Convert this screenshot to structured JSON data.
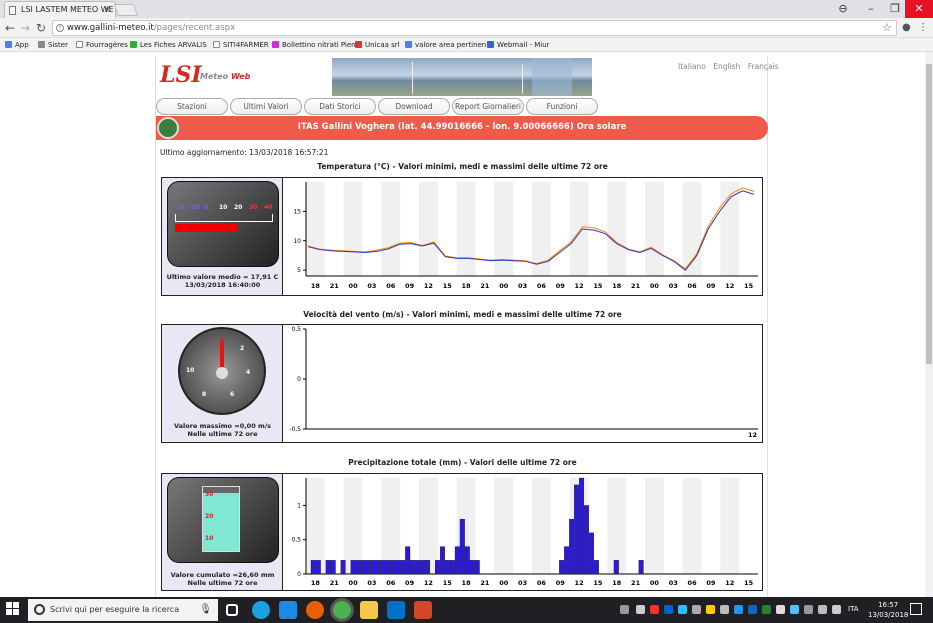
{
  "browser": {
    "tab_title": "LSI LASTEM METEO WE",
    "url_domain": "www.gallini-meteo.it",
    "url_path": "/pages/recent.aspx",
    "bookmarks": [
      "App",
      "Sister",
      "Fourragères",
      "Les Fiches ARVALIS",
      "SITI4FARMER",
      "Bollettino nitrati Pien",
      "Unicaa srl",
      "valore area pertinen",
      "Webmail - Miur"
    ]
  },
  "site": {
    "logo_lsi": "LSI",
    "logo_meteo": "Meteo",
    "logo_web": "Web",
    "languages": [
      "Italiano",
      "English",
      "Français"
    ],
    "menu": [
      "Stazioni",
      "Ultimi Valori",
      "Dati Storici",
      "Download",
      "Report Giornalieri",
      "Funzioni"
    ],
    "station_title": "ITAS Gallini Voghera (lat. 44.99016666 - lon. 9.00066666) Ora solare",
    "last_update": "Ultimo aggiornamento: 13/03/2018 16:57:21"
  },
  "charts": {
    "temp": {
      "title": "Temperatura (°C) - Valori minimi, medi e massimi delle ultime 72 ore",
      "scale_labels": [
        "-20",
        "-10",
        "0",
        "10",
        "20",
        "30",
        "40"
      ],
      "caption1": "Ultimo valore medio = 17,91 C",
      "caption2": "13/03/2018 16:40:00"
    },
    "wind": {
      "title": "Velocità del vento (m/s) - Valori minimi, medi e massimi delle ultime 72 ore",
      "dial_labels": [
        "2",
        "4",
        "6",
        "8",
        "10"
      ],
      "caption1": "Valore massimo =0,00 m/s",
      "caption2": "Nelle ultime 72 ore"
    },
    "rain": {
      "title": "Precipitazione totale (mm) - Valori delle ultime 72 ore",
      "tube_labels": [
        "30",
        "20",
        "10"
      ],
      "caption1": "Valore cumulato =26,60 mm",
      "caption2": "Nelle ultime 72 ore"
    }
  },
  "chart_data": [
    {
      "type": "line",
      "title": "Temperatura (°C) - Valori minimi, medi e massimi delle ultime 72 ore",
      "x_ticks": [
        "18",
        "21",
        "00",
        "03",
        "06",
        "09",
        "12",
        "15",
        "18",
        "21",
        "00",
        "03",
        "06",
        "09",
        "12",
        "15",
        "18",
        "21",
        "00",
        "03",
        "06",
        "09",
        "12",
        "15"
      ],
      "ylim": [
        4,
        20
      ],
      "y_ticks": [
        5,
        10,
        15
      ],
      "grid": true,
      "series": [
        {
          "color": "#3333cc",
          "values": [
            9.0,
            8.5,
            8.3,
            8.2,
            8.1,
            8.0,
            8.2,
            8.6,
            9.4,
            9.5,
            9.1,
            9.6,
            7.3,
            7.0,
            7.0,
            6.8,
            6.6,
            6.7,
            6.6,
            6.5,
            6.0,
            6.5,
            8.0,
            9.5,
            12.0,
            11.8,
            11.2,
            9.5,
            8.5,
            8.0,
            8.7,
            7.5,
            6.5,
            5.0,
            7.5,
            12.0,
            15.0,
            17.5,
            18.5,
            17.9
          ]
        },
        {
          "color": "#ff8800",
          "values": [
            9.1,
            8.6,
            8.4,
            8.3,
            8.2,
            8.1,
            8.4,
            8.8,
            9.6,
            9.7,
            9.2,
            9.8,
            7.4,
            7.1,
            7.1,
            6.9,
            6.7,
            6.8,
            6.7,
            6.6,
            6.1,
            6.7,
            8.3,
            9.8,
            12.4,
            12.2,
            11.5,
            9.7,
            8.6,
            8.1,
            8.9,
            7.6,
            6.6,
            5.2,
            7.8,
            12.5,
            15.6,
            18.0,
            19.0,
            18.4
          ]
        }
      ]
    },
    {
      "type": "line",
      "title": "Velocità del vento (m/s) - Valori minimi, medi e massimi delle ultime 72 ore",
      "ylim": [
        -0.5,
        0.5
      ],
      "y_ticks": [
        "-0,5",
        "0",
        "0,5"
      ],
      "x_ticks": [
        "12"
      ],
      "series": []
    },
    {
      "type": "bar",
      "title": "Precipitazione totale (mm) - Valori delle ultime 72 ore",
      "x_ticks": [
        "18",
        "21",
        "00",
        "03",
        "06",
        "09",
        "12",
        "15",
        "18",
        "21",
        "00",
        "03",
        "06",
        "09",
        "12",
        "15",
        "18",
        "21",
        "00",
        "03",
        "06",
        "09",
        "12",
        "15"
      ],
      "ylim": [
        0,
        1.4
      ],
      "y_ticks": [
        "0",
        "0,5",
        "1"
      ],
      "grid": true,
      "values": [
        0,
        0.2,
        0.2,
        0,
        0.2,
        0.2,
        0,
        0.2,
        0,
        0.2,
        0.2,
        0.2,
        0.2,
        0.2,
        0.2,
        0.2,
        0.2,
        0.2,
        0.2,
        0.2,
        0.4,
        0.2,
        0.2,
        0.2,
        0.2,
        0,
        0.2,
        0.4,
        0.2,
        0.2,
        0.4,
        0.8,
        0.4,
        0.2,
        0.2,
        0,
        0,
        0,
        0,
        0,
        0,
        0,
        0,
        0,
        0,
        0,
        0,
        0,
        0,
        0,
        0,
        0.2,
        0.4,
        0.8,
        1.3,
        1.4,
        1.0,
        0.6,
        0.2,
        0,
        0,
        0,
        0.2,
        0,
        0,
        0,
        0,
        0.2,
        0,
        0,
        0,
        0,
        0,
        0,
        0,
        0,
        0,
        0,
        0,
        0,
        0,
        0,
        0,
        0,
        0,
        0,
        0,
        0,
        0,
        0,
        0
      ]
    }
  ],
  "taskbar": {
    "search_placeholder": "Scrivi qui per eseguire la ricerca",
    "lang": "ITA",
    "time": "16:57",
    "date": "13/03/2018"
  }
}
